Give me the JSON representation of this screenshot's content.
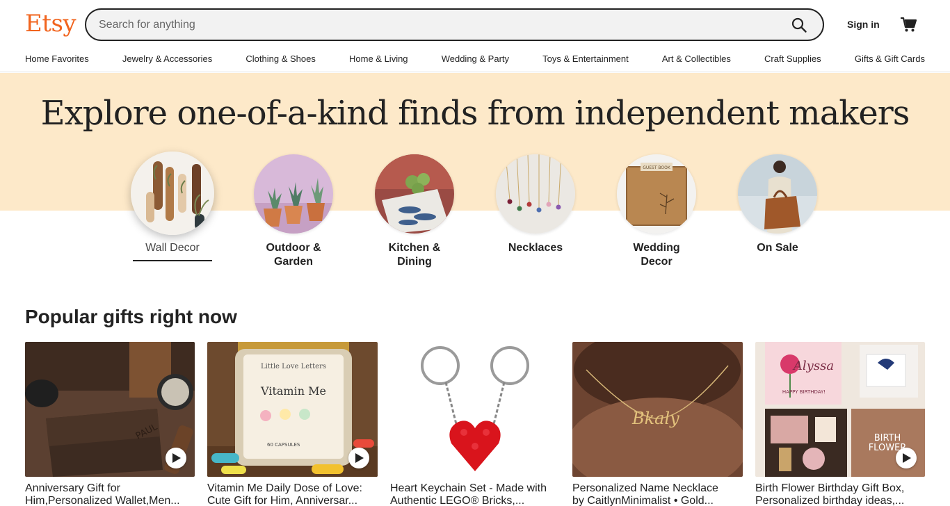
{
  "header": {
    "logo": "Etsy",
    "search_placeholder": "Search for anything",
    "sign_in": "Sign in"
  },
  "nav": [
    "Home Favorites",
    "Jewelry & Accessories",
    "Clothing & Shoes",
    "Home & Living",
    "Wedding & Party",
    "Toys & Entertainment",
    "Art & Collectibles",
    "Craft Supplies",
    "Gifts & Gift Cards"
  ],
  "hero": {
    "title": "Explore one-of-a-kind finds from independent makers"
  },
  "categories": [
    {
      "line1": "Wall Decor",
      "line2": "",
      "icon": "wall-decor"
    },
    {
      "line1": "Outdoor &",
      "line2": "Garden",
      "icon": "succulents"
    },
    {
      "line1": "Kitchen &",
      "line2": "Dining",
      "icon": "tea-towel"
    },
    {
      "line1": "Necklaces",
      "line2": "",
      "icon": "necklaces"
    },
    {
      "line1": "Wedding",
      "line2": "Decor",
      "icon": "guest-book"
    },
    {
      "line1": "On Sale",
      "line2": "",
      "icon": "leather-bag"
    }
  ],
  "popular": {
    "title": "Popular gifts right now",
    "items": [
      {
        "line1": "Anniversary Gift for",
        "line2": "Him,Personalized Wallet,Men...",
        "video": true
      },
      {
        "line1": "Vitamin Me Daily Dose of Love:",
        "line2": "Cute Gift for Him, Anniversar...",
        "video": true
      },
      {
        "line1": "Heart Keychain Set - Made with",
        "line2": "Authentic LEGO® Bricks,...",
        "video": false
      },
      {
        "line1": "Personalized Name Necklace",
        "line2": "by CaitlynMinimalist • Gold...",
        "video": false
      },
      {
        "line1": "Birth Flower Birthday Gift Box,",
        "line2": "Personalized birthday ideas,...",
        "video": true
      }
    ]
  },
  "image_text": {
    "wallet_engraving": "PAUL",
    "jar_label_top": "Little Love Letters",
    "jar_label_title": "Vitamin Me",
    "jar_label_bottom": "60 CAPSULES",
    "necklace_name": "Bkaly",
    "giftbox_name": "Alyssa",
    "giftbox_greeting": "HAPPY BIRTHDAY!",
    "giftbox_title1": "BIRTH",
    "giftbox_title2": "FLOWER",
    "guestbook_label": "GUEST BOOK"
  },
  "colors": {
    "brand": "#f1641e",
    "hero_band": "#fde9c9"
  }
}
